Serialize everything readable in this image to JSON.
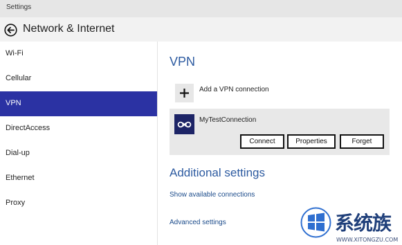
{
  "window": {
    "title": "Settings"
  },
  "header": {
    "title": "Network & Internet",
    "back_icon": "back-arrow-icon"
  },
  "sidebar": {
    "items": [
      {
        "label": "Wi-Fi",
        "active": false
      },
      {
        "label": "Cellular",
        "active": false
      },
      {
        "label": "VPN",
        "active": true
      },
      {
        "label": "DirectAccess",
        "active": false
      },
      {
        "label": "Dial-up",
        "active": false
      },
      {
        "label": "Ethernet",
        "active": false
      },
      {
        "label": "Proxy",
        "active": false
      }
    ]
  },
  "main": {
    "section_title": "VPN",
    "add_vpn": {
      "label": "Add a VPN connection",
      "icon": "plus-icon"
    },
    "connection": {
      "name": "MyTestConnection",
      "icon": "vpn-link-icon",
      "buttons": {
        "connect": "Connect",
        "properties": "Properties",
        "forget": "Forget"
      }
    },
    "additional": {
      "title": "Additional settings",
      "links": [
        "Show available connections",
        "Advanced settings"
      ]
    }
  },
  "watermark": {
    "text": "系统族",
    "url": "WWW.XITONGZU.COM"
  },
  "colors": {
    "accent": "#2b32a3",
    "link": "#2c5aa0",
    "connection_icon_bg": "#1d2466"
  }
}
